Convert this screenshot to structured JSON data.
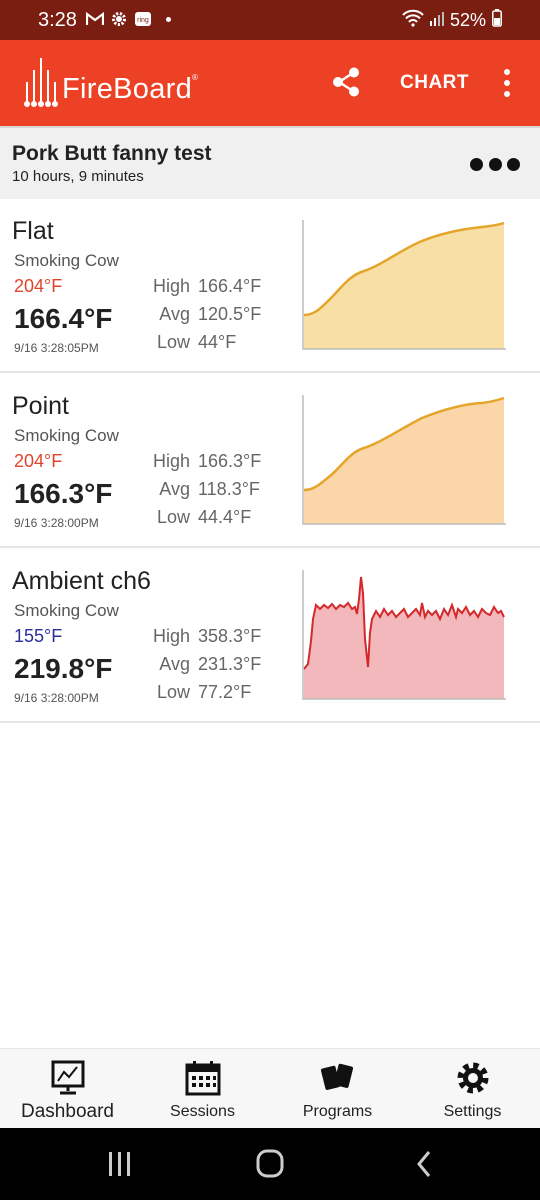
{
  "status_bar": {
    "time": "3:28",
    "notification_icons": [
      "gmail-icon",
      "settings-gear-icon",
      "ring-icon"
    ],
    "battery": "52%",
    "icons": [
      "wifi-icon",
      "signal-icon",
      "battery-icon"
    ]
  },
  "app_bar": {
    "logo_text": "FireBoard",
    "trademark": "®",
    "chart_label": "CHART",
    "share_icon": "share-icon",
    "menu_icon": "kebab-menu-icon",
    "background": "#ec4124"
  },
  "session": {
    "title": "Pork Butt fanny test",
    "duration": "10 hours, 9 minutes",
    "more_icon": "more-horizontal-icon"
  },
  "probes": [
    {
      "name": "Flat",
      "device": "Smoking Cow",
      "target": "204°F",
      "target_color": "#e0452c",
      "current": "166.4°F",
      "timestamp": "9/16 3:28:05PM",
      "high_label": "High",
      "high": "166.4°F",
      "avg_label": "Avg",
      "avg": "120.5°F",
      "low_label": "Low",
      "low": "44°F",
      "line_color": "#e5a42a",
      "fill_color": "#f7dfa5"
    },
    {
      "name": "Point",
      "device": "Smoking Cow",
      "target": "204°F",
      "target_color": "#e0452c",
      "current": "166.3°F",
      "timestamp": "9/16 3:28:00PM",
      "high_label": "High",
      "high": "166.3°F",
      "avg_label": "Avg",
      "avg": "118.3°F",
      "low_label": "Low",
      "low": "44.4°F",
      "line_color": "#e5a42a",
      "fill_color": "#fbd6a8"
    },
    {
      "name": "Ambient ch6",
      "device": "Smoking Cow",
      "target": "155°F",
      "target_color": "#2a2f9a",
      "current": "219.8°F",
      "timestamp": "9/16 3:28:00PM",
      "high_label": "High",
      "high": "358.3°F",
      "avg_label": "Avg",
      "avg": "231.3°F",
      "low_label": "Low",
      "low": "77.2°F",
      "line_color": "#d4282b",
      "fill_color": "#f2b8bb"
    }
  ],
  "bottom_nav": [
    {
      "label": "Dashboard",
      "icon": "dashboard-chart-icon",
      "active": true
    },
    {
      "label": "Sessions",
      "icon": "calendar-icon",
      "active": false
    },
    {
      "label": "Programs",
      "icon": "cards-icon",
      "active": false
    },
    {
      "label": "Settings",
      "icon": "gear-icon",
      "active": false
    }
  ],
  "system_nav": [
    "recents-icon",
    "home-icon",
    "back-icon"
  ]
}
